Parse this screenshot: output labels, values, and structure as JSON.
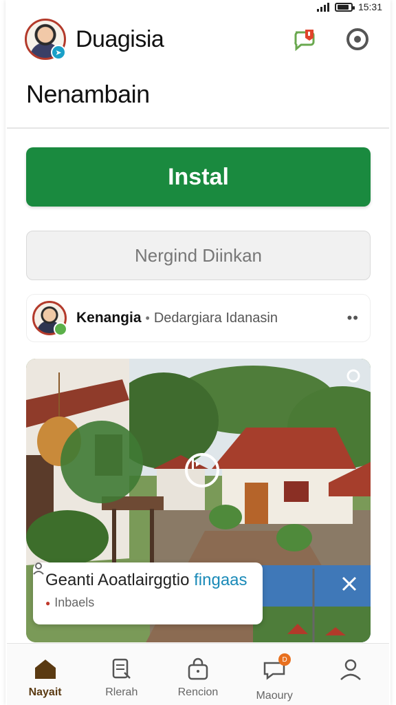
{
  "status_bar": {
    "time": "15:31"
  },
  "header": {
    "app_title": "Duagisia"
  },
  "page": {
    "title": "Nenambain"
  },
  "actions": {
    "install_label": "Instal",
    "secondary_label": "Nergind Diinkan"
  },
  "post": {
    "author": "Kenangia",
    "separator": "•",
    "subtitle": "Dedargiara Idanasin",
    "more": "••"
  },
  "media": {
    "caption_title_main": "Geanti Aoatlairggtio ",
    "caption_title_accent": "fingaas",
    "caption_meta": "Inbaels"
  },
  "bottom_nav": [
    {
      "label": "Nayait",
      "icon": "home-icon",
      "active": true
    },
    {
      "label": "Rlerah",
      "icon": "document-icon",
      "active": false
    },
    {
      "label": "Rencion",
      "icon": "bag-icon",
      "active": false
    },
    {
      "label": "Maoury",
      "icon": "chat-notification-icon",
      "active": false,
      "badge": "D"
    },
    {
      "label": "",
      "icon": "profile-icon",
      "active": false
    }
  ],
  "colors": {
    "primary": "#1a8a3f",
    "accent_link": "#1a8ab8",
    "nav_active": "#5a3a12",
    "badge": "#e8701f"
  }
}
